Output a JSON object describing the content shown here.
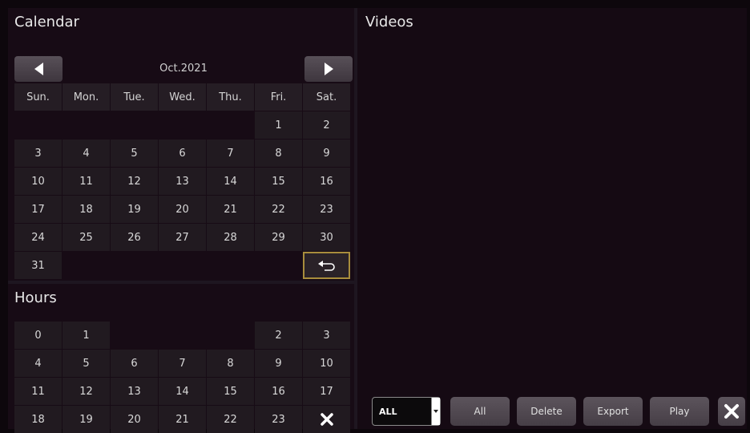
{
  "calendar": {
    "title": "Calendar",
    "month": "Oct.2021",
    "weekdays": [
      "Sun.",
      "Mon.",
      "Tue.",
      "Wed.",
      "Thu.",
      "Fri.",
      "Sat."
    ],
    "days": [
      "",
      "",
      "",
      "",
      "",
      "1",
      "2",
      "3",
      "4",
      "5",
      "6",
      "7",
      "8",
      "9",
      "10",
      "11",
      "12",
      "13",
      "14",
      "15",
      "16",
      "17",
      "18",
      "19",
      "20",
      "21",
      "22",
      "23",
      "24",
      "25",
      "26",
      "27",
      "28",
      "29",
      "30",
      "31",
      "",
      "",
      "",
      "",
      "",
      "back"
    ]
  },
  "hours": {
    "title": "Hours",
    "cells": [
      "0",
      "1",
      "",
      "",
      "",
      "2",
      "3",
      "4",
      "5",
      "6",
      "7",
      "8",
      "9",
      "10",
      "11",
      "12",
      "13",
      "14",
      "15",
      "16",
      "17",
      "18",
      "19",
      "20",
      "21",
      "22",
      "23",
      "close"
    ]
  },
  "videos": {
    "title": "Videos",
    "filter_value": "ALL",
    "buttons": {
      "all": "All",
      "delete": "Delete",
      "export": "Export",
      "play": "Play"
    }
  },
  "icons": {
    "prev": "left-arrow-icon",
    "next": "right-arrow-icon",
    "back": "back-arrow-icon",
    "close": "close-icon"
  }
}
